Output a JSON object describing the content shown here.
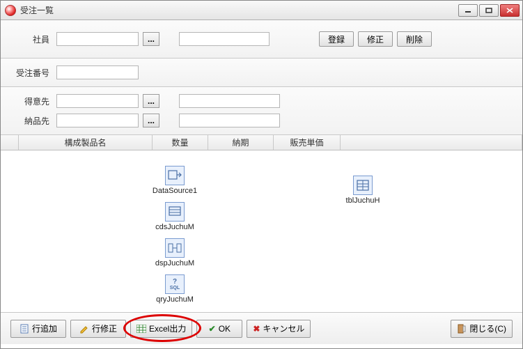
{
  "window": {
    "title": "受注一覧"
  },
  "labels": {
    "shain": "社員",
    "juchuNo": "受注番号",
    "tokui": "得意先",
    "nouhin": "納品先"
  },
  "topButtons": {
    "register": "登録",
    "modify": "修正",
    "delete": "削除"
  },
  "fields": {
    "shainCode": "",
    "shainName": "",
    "juchuNo": "",
    "tokuiCode": "",
    "tokuiName": "",
    "nouhinCode": "",
    "nouhinName": ""
  },
  "ellipsis": "...",
  "gridHeaders": {
    "col1": "構成製品名",
    "col2": "数量",
    "col3": "納期",
    "col4": "販売単価"
  },
  "components": {
    "ds1": "DataSource1",
    "cds": "cdsJuchuM",
    "dsp": "dspJuchuM",
    "qry": "qryJuchuM",
    "tbl": "tblJuchuH",
    "sqlGlyph": "SQL",
    "qGlyph": "?"
  },
  "footer": {
    "addRow": "行追加",
    "editRow": "行修正",
    "excel": "Excel出力",
    "ok": "OK",
    "cancel": "キャンセル",
    "close": "閉じる(C)"
  }
}
